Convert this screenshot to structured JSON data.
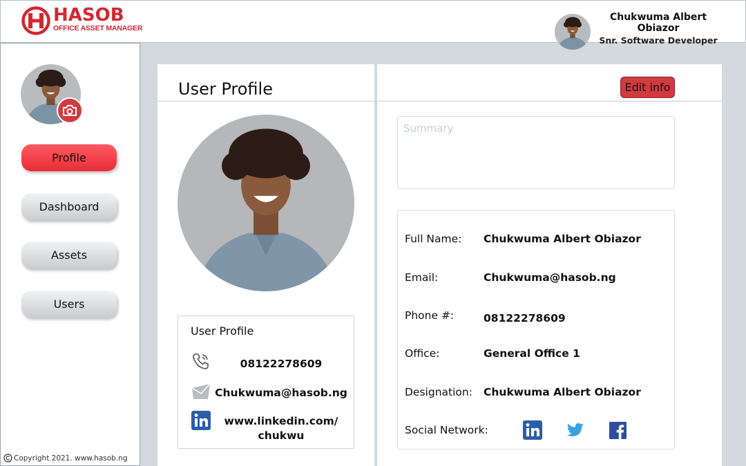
{
  "brand": {
    "name": "HASOB",
    "tagline": "OFFICE ASSET MANAGER",
    "color": "#d2282f"
  },
  "header": {
    "user_name": "Chukwuma Albert Obiazor",
    "user_role": "Snr. Software Developer"
  },
  "sidebar": {
    "items": [
      {
        "label": "Profile",
        "active": true
      },
      {
        "label": "Dashboard",
        "active": false
      },
      {
        "label": "Assets",
        "active": false
      },
      {
        "label": "Users",
        "active": false
      }
    ],
    "copyright": "Copyright 2021. www.hasob.ng"
  },
  "profile_panel": {
    "title": "User Profile",
    "card_title": "User Profile",
    "phone": "08122278609",
    "email": "Chukwuma@hasob.ng",
    "linkedin": "www.linkedin.com/ chukwu"
  },
  "details_panel": {
    "edit_label": "Edit info",
    "summary_placeholder": "Summary",
    "fields": [
      {
        "label": "Full Name:",
        "value": "Chukwuma Albert Obiazor"
      },
      {
        "label": "Email:",
        "value": "Chukwuma@hasob.ng"
      },
      {
        "label": "Phone #:",
        "value": "08122278609"
      },
      {
        "label": "Office:",
        "value": "General Office 1"
      },
      {
        "label": "Designation:",
        "value": "Chukwuma Albert Obiazor"
      }
    ],
    "social_label": "Social Network:",
    "social_icons": [
      "linkedin-icon",
      "twitter-icon",
      "facebook-icon"
    ]
  },
  "colors": {
    "accent_red": "#e82c36",
    "edit_button": "#d23a40",
    "linkedin": "#2c5da8",
    "twitter": "#3aa1e0",
    "facebook": "#2e4fa0"
  }
}
